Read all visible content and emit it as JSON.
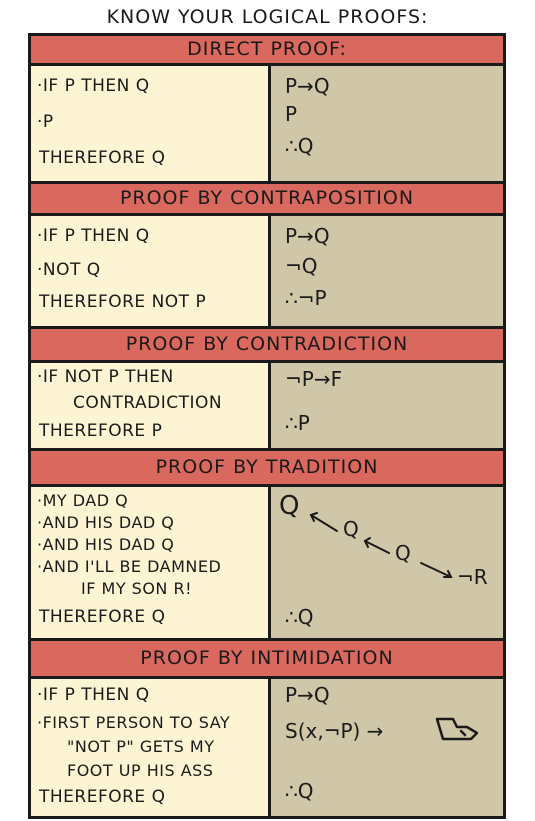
{
  "title": "Know your logical proofs:",
  "sections": [
    {
      "header": "Direct proof:",
      "premises": [
        "·If P then Q",
        "·P",
        "Therefore Q"
      ],
      "symbols": [
        "P→Q",
        "P",
        "∴Q"
      ]
    },
    {
      "header": "Proof by contraposition",
      "premises": [
        "·If P then Q",
        "·Not Q",
        "Therefore not P"
      ],
      "symbols": [
        "P→Q",
        "¬Q",
        "∴¬P"
      ]
    },
    {
      "header": "Proof by contradiction",
      "premises": [
        "·If not P then",
        "contradiction",
        "Therefore P"
      ],
      "symbols": [
        "¬P→F",
        "∴P"
      ]
    },
    {
      "header": "Proof by tradition",
      "premises": [
        "·My dad Q",
        "·and his dad Q",
        "·and his dad Q",
        "·and I'll be damned",
        "if my son R!",
        "Therefore Q"
      ],
      "symbols": [
        "Q",
        "Q",
        "Q",
        "¬R",
        "∴Q"
      ]
    },
    {
      "header": "Proof by intimidation",
      "premises": [
        "·If P then Q",
        "·First person to say",
        "\"not P\" gets my",
        "foot up his ass",
        "Therefore Q"
      ],
      "symbols": [
        "P→Q",
        "S(x,¬P) →",
        "∴Q"
      ]
    }
  ],
  "colors": {
    "header": "#d9685e",
    "left_panel": "#fdf4d4",
    "right_panel": "#d0c7a8",
    "ink": "#1a1a1a"
  }
}
